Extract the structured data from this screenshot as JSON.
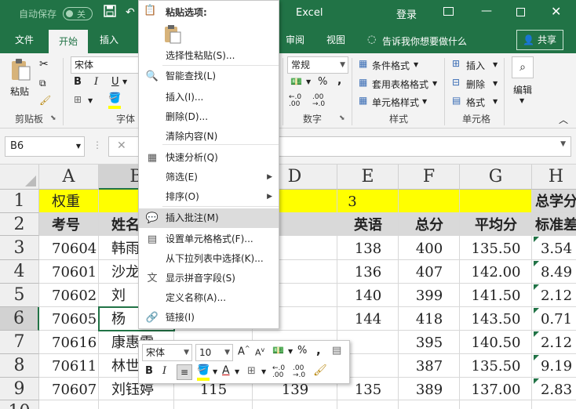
{
  "titlebar": {
    "autosave_label": "自动保存",
    "autosave_state": "关",
    "app_name": "Excel",
    "login": "登录"
  },
  "tabs": [
    {
      "label": "文件"
    },
    {
      "label": "开始"
    },
    {
      "label": "插入"
    },
    {
      "label": "审阅"
    },
    {
      "label": "视图"
    }
  ],
  "tellme": "告诉我你想要做什么",
  "share": "共享",
  "ribbon": {
    "paste": "粘贴",
    "clipboard_group": "剪贴板",
    "font_name": "宋体",
    "font_group": "字体",
    "number_format": "常规",
    "number_group": "数字",
    "conditional_format": "条件格式",
    "table_format": "套用表格格式",
    "cell_styles": "单元格样式",
    "styles_group": "样式",
    "insert_cells": "插入",
    "delete_cells": "删除",
    "format_cells": "格式",
    "cells_group": "单元格",
    "edit": "编辑",
    "bold": "B",
    "italic": "I",
    "underline": "U",
    "percent": "%",
    "comma": ","
  },
  "formula_bar": {
    "name_box": "B6",
    "fx": "fx",
    "formula": ""
  },
  "columns": [
    "A",
    "B",
    "C",
    "D",
    "E",
    "F",
    "G",
    "H"
  ],
  "rows": [
    {
      "num": "1",
      "cells": [
        "权重",
        "",
        "",
        "",
        "3",
        "",
        "",
        "总学分"
      ]
    },
    {
      "num": "2",
      "cells": [
        "考号",
        "姓名",
        "",
        "",
        "英语",
        "总分",
        "平均分",
        "标准差"
      ]
    },
    {
      "num": "3",
      "cells": [
        "70604",
        "韩雨",
        "",
        "",
        "138",
        "400",
        "135.50",
        "3.54"
      ]
    },
    {
      "num": "4",
      "cells": [
        "70601",
        "沙龙",
        "",
        "",
        "136",
        "407",
        "142.00",
        "8.49"
      ]
    },
    {
      "num": "5",
      "cells": [
        "70602",
        "刘",
        "",
        "",
        "140",
        "399",
        "141.50",
        "2.12"
      ]
    },
    {
      "num": "6",
      "cells": [
        "70605",
        "杨",
        "",
        "",
        "144",
        "418",
        "143.50",
        "0.71"
      ]
    },
    {
      "num": "7",
      "cells": [
        "70616",
        "康惠雪",
        "",
        "",
        "",
        "395",
        "140.50",
        "2.12"
      ]
    },
    {
      "num": "8",
      "cells": [
        "70611",
        "林世",
        "",
        "",
        "",
        "387",
        "135.50",
        "9.19"
      ]
    },
    {
      "num": "9",
      "cells": [
        "70607",
        "刘钰婷",
        "115",
        "139",
        "135",
        "389",
        "137.00",
        "2.83"
      ]
    },
    {
      "num": "10",
      "cells": [
        "",
        "",
        "",
        "",
        "",
        "",
        "",
        ""
      ]
    }
  ],
  "context_menu": {
    "paste_options_title": "粘贴选项:",
    "items": [
      {
        "label": "选择性粘贴(S)...",
        "icon": "paste-special-icon"
      },
      {
        "label": "智能查找(L)",
        "icon": "smart-lookup-icon"
      },
      {
        "label": "插入(I)...",
        "icon": ""
      },
      {
        "label": "删除(D)...",
        "icon": ""
      },
      {
        "label": "清除内容(N)",
        "icon": ""
      },
      {
        "label": "快速分析(Q)",
        "icon": "quick-analysis-icon"
      },
      {
        "label": "筛选(E)",
        "icon": ""
      },
      {
        "label": "排序(O)",
        "icon": ""
      },
      {
        "label": "插入批注(M)",
        "icon": "insert-comment-icon"
      },
      {
        "label": "设置单元格格式(F)...",
        "icon": "format-cells-icon"
      },
      {
        "label": "从下拉列表中选择(K)...",
        "icon": ""
      },
      {
        "label": "显示拼音字段(S)",
        "icon": "phonetic-icon"
      },
      {
        "label": "定义名称(A)...",
        "icon": ""
      },
      {
        "label": "链接(I)",
        "icon": "link-icon"
      }
    ]
  },
  "mini_toolbar": {
    "font": "宋体",
    "size": "10",
    "bold": "B",
    "italic": "I",
    "percent": "%",
    "comma": ","
  },
  "colors": {
    "excel_green": "#217346",
    "highlight_yellow": "#ffff00",
    "header_gray": "#d9d9d9"
  }
}
